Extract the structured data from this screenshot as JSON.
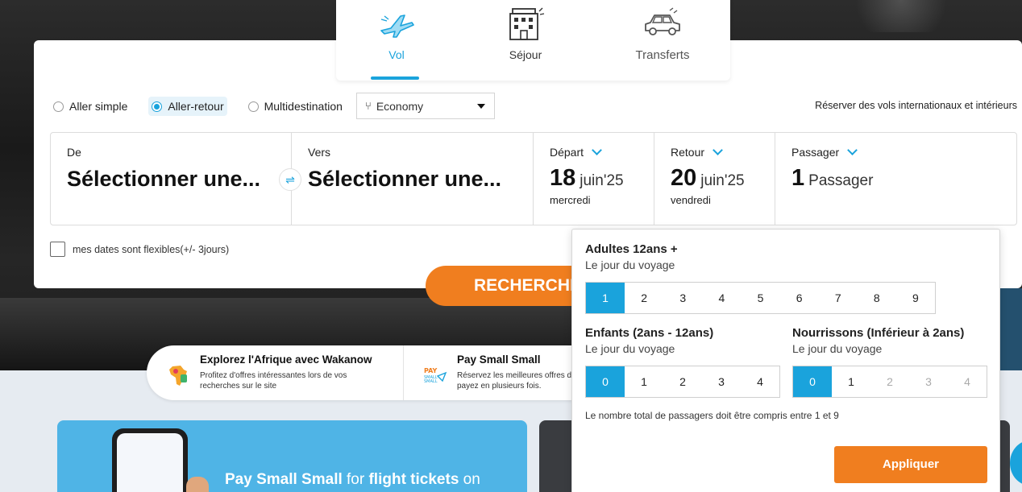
{
  "tabs": [
    {
      "label": "Vol",
      "icon": "plane-icon"
    },
    {
      "label": "Séjour",
      "icon": "hotel-icon"
    },
    {
      "label": "Transferts",
      "icon": "car-icon"
    }
  ],
  "trip_types": {
    "one_way": "Aller simple",
    "round_trip": "Aller-retour",
    "multi": "Multidestination",
    "selected": "Aller-retour"
  },
  "cabin": {
    "value": "Economy",
    "icon": "seat-icon"
  },
  "intl_note": "Réserver des vols internationaux et intérieurs",
  "from": {
    "label": "De",
    "value": "Sélectionner une..."
  },
  "to": {
    "label": "Vers",
    "value": "Sélectionner une..."
  },
  "swap_icon": "⇌",
  "departure": {
    "label": "Départ",
    "day": "18",
    "month": "juin'25",
    "weekday": "mercredi"
  },
  "return": {
    "label": "Retour",
    "day": "20",
    "month": "juin'25",
    "weekday": "vendredi"
  },
  "passengers": {
    "label": "Passager",
    "count": "1",
    "unit": "Passager"
  },
  "flexible_label": "mes dates sont flexibles(+/- 3jours)",
  "search_button": "RECHERCHER",
  "promos": [
    {
      "title": "Explorez l'Afrique avec Wakanow",
      "desc": "Profitez d'offres intéressantes lors de vos recherches sur le site",
      "icon": "africa-map-icon"
    },
    {
      "title": "Pay Small Small",
      "desc": "Réservez les meilleures offres de vol et payez en plusieurs fois.",
      "icon": "pay-small-small-icon"
    }
  ],
  "banner": {
    "bold1": "Pay Small Small",
    "text1": " for ",
    "bold2": "flight tickets",
    "text2": " on"
  },
  "pax_panel": {
    "adults": {
      "title": "Adultes 12ans +",
      "sub": "Le jour du voyage",
      "options": [
        "1",
        "2",
        "3",
        "4",
        "5",
        "6",
        "7",
        "8",
        "9"
      ],
      "selected": "1"
    },
    "children": {
      "title": "Enfants (2ans - 12ans)",
      "sub": "Le jour du voyage",
      "options": [
        "0",
        "1",
        "2",
        "3",
        "4"
      ],
      "selected": "0"
    },
    "infants": {
      "title": "Nourrissons (Inférieur à 2ans)",
      "sub": "Le jour du voyage",
      "options": [
        "0",
        "1",
        "2",
        "3",
        "4"
      ],
      "selected": "0",
      "disabled": [
        "2",
        "3",
        "4"
      ]
    },
    "note": "Le nombre total de passagers doit être compris entre 1 et 9",
    "apply": "Appliquer"
  },
  "colors": {
    "accent": "#1aa3dc",
    "cta": "#f07e1f"
  }
}
